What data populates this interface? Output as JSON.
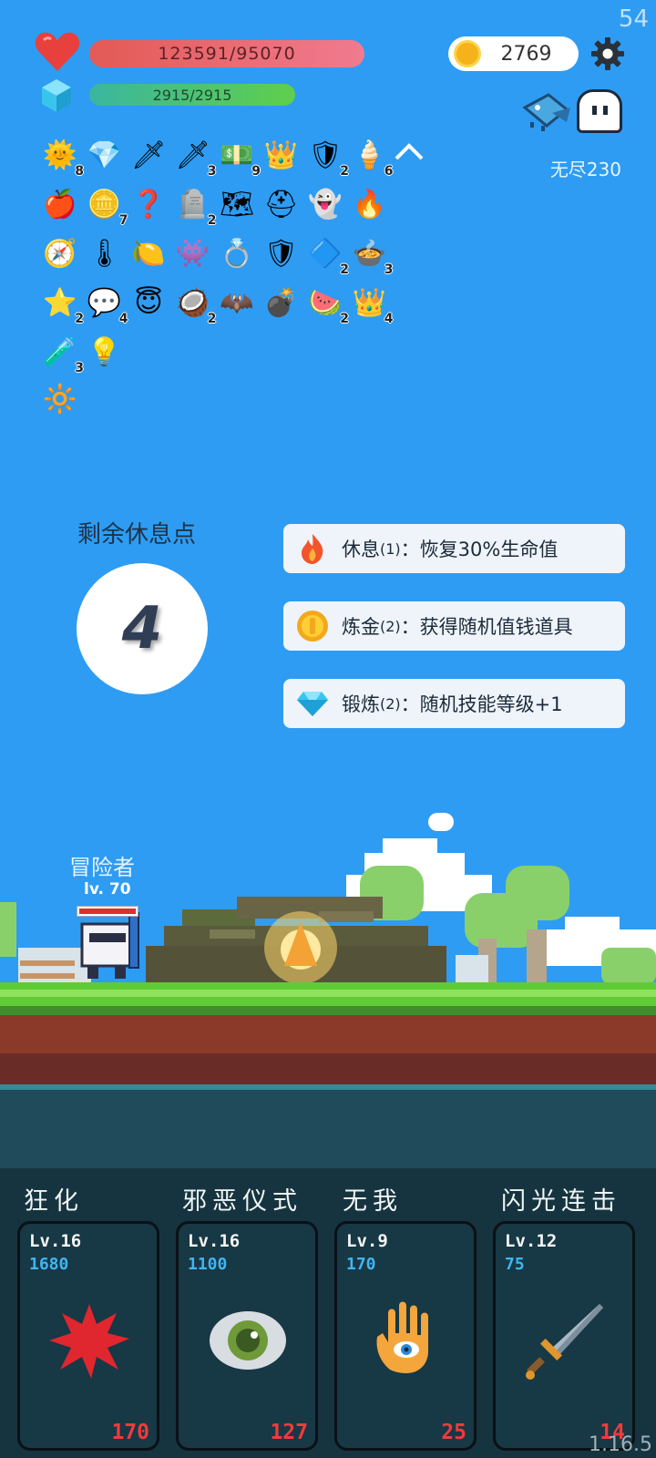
{
  "fps": "54",
  "status": {
    "hp": "123591/95070",
    "mp": "2915/2915",
    "coins": "2769",
    "endless": "无尽230"
  },
  "items": [
    {
      "icon": "sun-icon",
      "glyph": "🌞",
      "count": "8"
    },
    {
      "icon": "ruby-icon",
      "glyph": "💎",
      "count": ""
    },
    {
      "icon": "sword-icon",
      "glyph": "🗡",
      "count": ""
    },
    {
      "icon": "steel-sword-icon",
      "glyph": "🗡",
      "count": "3"
    },
    {
      "icon": "money-heart-icon",
      "glyph": "💵",
      "count": "9"
    },
    {
      "icon": "crown-icon",
      "glyph": "👑",
      "count": ""
    },
    {
      "icon": "shield-round-icon",
      "glyph": "🛡",
      "count": "2"
    },
    {
      "icon": "ice-cream-icon",
      "glyph": "🍦",
      "count": "6"
    },
    {
      "icon": "apple-icon",
      "glyph": "🍎",
      "count": ""
    },
    {
      "icon": "coin-stack-icon",
      "glyph": "🪙",
      "count": "7"
    },
    {
      "icon": "hook-icon",
      "glyph": "❓",
      "count": ""
    },
    {
      "icon": "tombstone-icon",
      "glyph": "🪦",
      "count": "2"
    },
    {
      "icon": "treasure-map-icon",
      "glyph": "🗺",
      "count": ""
    },
    {
      "icon": "helmet-icon",
      "glyph": "⛑",
      "count": ""
    },
    {
      "icon": "ghost-icon",
      "glyph": "👻",
      "count": ""
    },
    {
      "icon": "torch-icon",
      "glyph": "🔥",
      "count": ""
    },
    {
      "icon": "compass-icon",
      "glyph": "🧭",
      "count": ""
    },
    {
      "icon": "thermometer-icon",
      "glyph": "🌡",
      "count": ""
    },
    {
      "icon": "lime-icon",
      "glyph": "🍋",
      "count": ""
    },
    {
      "icon": "green-monster-icon",
      "glyph": "👾",
      "count": ""
    },
    {
      "icon": "ring-icon",
      "glyph": "💍",
      "count": ""
    },
    {
      "icon": "shield-icon",
      "glyph": "🛡",
      "count": ""
    },
    {
      "icon": "sapphire-icon",
      "glyph": "🔷",
      "count": "2"
    },
    {
      "icon": "cauldron-icon",
      "glyph": "🍲",
      "count": "3"
    },
    {
      "icon": "star-card-icon",
      "glyph": "⭐",
      "count": "2"
    },
    {
      "icon": "speech-bubble-icon",
      "glyph": "💬",
      "count": "4"
    },
    {
      "icon": "halo-icon",
      "glyph": "😇",
      "count": ""
    },
    {
      "icon": "coconut-icon",
      "glyph": "🥥",
      "count": "2"
    },
    {
      "icon": "bat-icon",
      "glyph": "🦇",
      "count": ""
    },
    {
      "icon": "grenade-icon",
      "glyph": "💣",
      "count": ""
    },
    {
      "icon": "watermelon-icon",
      "glyph": "🍉",
      "count": "2"
    },
    {
      "icon": "gold-crown-icon",
      "glyph": "👑",
      "count": "4"
    },
    {
      "icon": "potion-flask-icon",
      "glyph": "🧪",
      "count": "3"
    },
    {
      "icon": "lightbulb-icon",
      "glyph": "💡",
      "count": ""
    },
    {
      "icon": "glowing-card-icon",
      "glyph": "🔆",
      "count": ""
    }
  ],
  "rest": {
    "title": "剩余休息点",
    "points": "4",
    "options": [
      {
        "icon": "fire-icon",
        "name": "休息",
        "count": "(1)",
        "desc": "：恢复30%生命值"
      },
      {
        "icon": "coin-icon",
        "name": "炼金",
        "count": "(2)",
        "desc": "：获得随机值钱道具"
      },
      {
        "icon": "diamond-icon",
        "name": "锻炼",
        "count": "(2)",
        "desc": "：随机技能等级+1"
      }
    ]
  },
  "player": {
    "name": "冒险者",
    "level": "lv. 70"
  },
  "skills": [
    {
      "name": "狂化",
      "level": "Lv.16",
      "cost": "1680",
      "value": "170",
      "icon": "blood-splat-icon"
    },
    {
      "name": "邪恶仪式",
      "level": "Lv.16",
      "cost": "1100",
      "value": "127",
      "icon": "eye-icon"
    },
    {
      "name": "无我",
      "level": "Lv.9",
      "cost": "170",
      "value": "25",
      "icon": "hamsa-hand-icon"
    },
    {
      "name": "闪光连击",
      "level": "Lv.12",
      "cost": "75",
      "value": "14",
      "icon": "sword-icon"
    }
  ],
  "version": "1.16.5"
}
